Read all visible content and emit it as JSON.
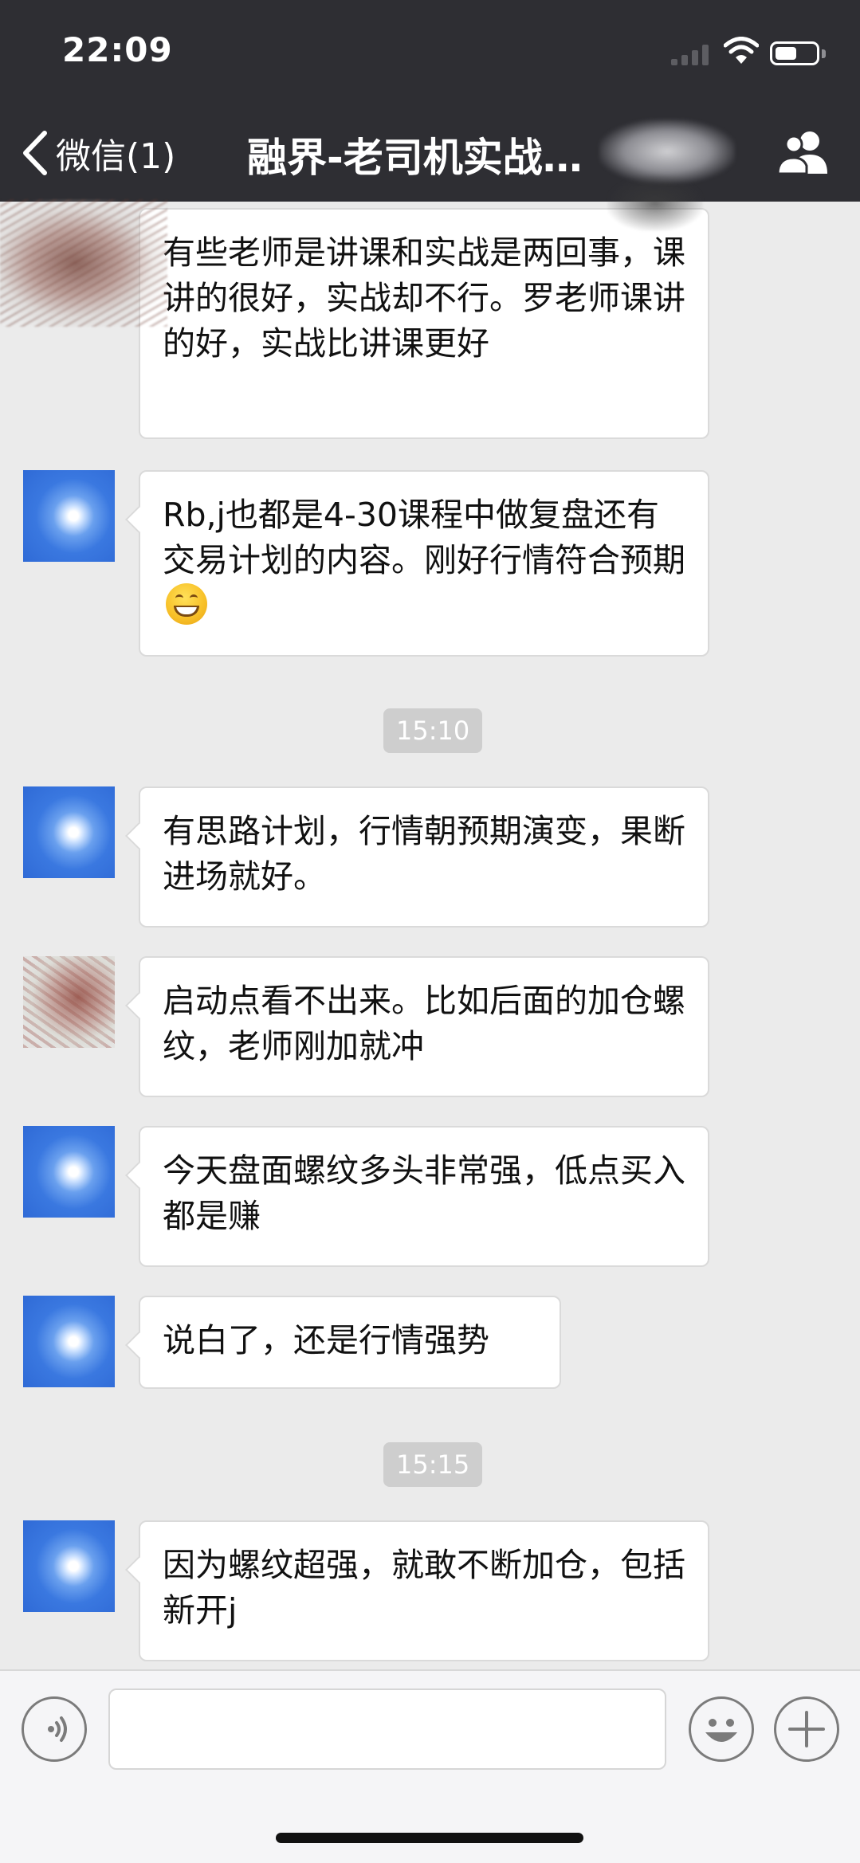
{
  "status_bar": {
    "time": "22:09",
    "battery_level": 0.55
  },
  "nav": {
    "back_label": "微信(1)",
    "title": "融界-老司机实战…"
  },
  "messages": [
    {
      "text": "有些老师是讲课和实战是两回事，课讲的很好，实战却不行。罗老师课讲的好，实战比讲课更好"
    },
    {
      "text": "Rb,j也都是4-30课程中做复盘还有交易计划的内容。刚好行情符合预期",
      "emoji": "grinning-face"
    },
    {
      "time": "15:10"
    },
    {
      "text": "有思路计划，行情朝预期演变，果断进场就好。"
    },
    {
      "text": "启动点看不出来。比如后面的加仓螺纹，老师刚加就冲"
    },
    {
      "text": "今天盘面螺纹多头非常强，低点买入都是赚"
    },
    {
      "text": "说白了，还是行情强势"
    },
    {
      "time": "15:15"
    },
    {
      "text": "因为螺纹超强，就敢不断加仓，包括新开j"
    }
  ],
  "input_bar": {
    "voice_icon": "voice-icon",
    "emoji_icon": "emoji-icon",
    "plus_icon": "plus-icon",
    "message_value": ""
  },
  "colors": {
    "header_bg": "#2e2e33",
    "chat_bg": "#ebebeb",
    "bubble_bg": "#ffffff",
    "time_pill_bg": "#cecece"
  }
}
